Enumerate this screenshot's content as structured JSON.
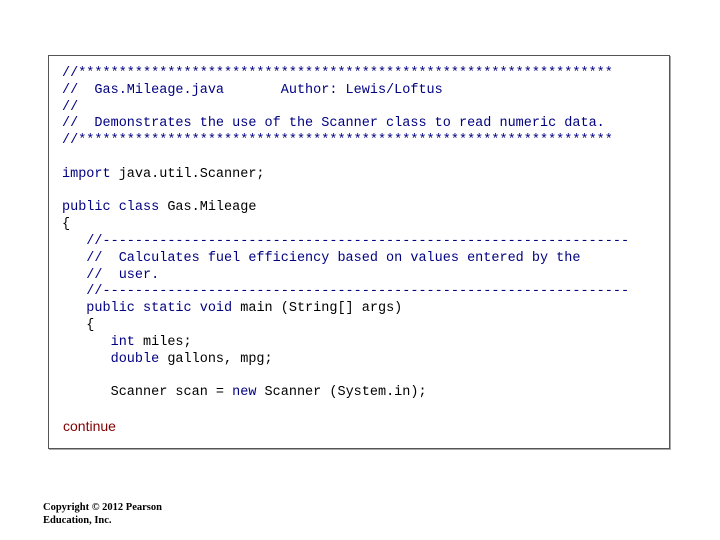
{
  "code_lines": [
    [
      {
        "t": "//******************************************************************",
        "c": "comment"
      }
    ],
    [
      {
        "t": "//  Gas.Mileage.java       Author: Lewis/Loftus",
        "c": "comment"
      }
    ],
    [
      {
        "t": "//",
        "c": "comment"
      }
    ],
    [
      {
        "t": "//  Demonstrates the use of the Scanner class to read numeric data.",
        "c": "comment"
      }
    ],
    [
      {
        "t": "//******************************************************************",
        "c": "comment"
      }
    ],
    [],
    [
      {
        "t": "import",
        "c": "kw"
      },
      {
        "t": " java.util.Scanner;",
        "c": "plain"
      }
    ],
    [],
    [
      {
        "t": "public class",
        "c": "kw"
      },
      {
        "t": " Gas.Mileage",
        "c": "plain"
      }
    ],
    [
      {
        "t": "{",
        "c": "plain"
      }
    ],
    [
      {
        "t": "   //-----------------------------------------------------------------",
        "c": "comment"
      }
    ],
    [
      {
        "t": "   //  Calculates fuel efficiency based on values entered by the",
        "c": "comment"
      }
    ],
    [
      {
        "t": "   //  user.",
        "c": "comment"
      }
    ],
    [
      {
        "t": "   //-----------------------------------------------------------------",
        "c": "comment"
      }
    ],
    [
      {
        "t": "   public static void",
        "c": "kw"
      },
      {
        "t": " main (String[] args)",
        "c": "plain"
      }
    ],
    [
      {
        "t": "   {",
        "c": "plain"
      }
    ],
    [
      {
        "t": "      ",
        "c": "plain"
      },
      {
        "t": "int",
        "c": "kw"
      },
      {
        "t": " miles;",
        "c": "plain"
      }
    ],
    [
      {
        "t": "      ",
        "c": "plain"
      },
      {
        "t": "double",
        "c": "kw"
      },
      {
        "t": " gallons, mpg;",
        "c": "plain"
      }
    ],
    [],
    [
      {
        "t": "      Scanner scan = ",
        "c": "plain"
      },
      {
        "t": "new",
        "c": "kw"
      },
      {
        "t": " Scanner (System.in);",
        "c": "plain"
      }
    ]
  ],
  "continue_label": "continue",
  "copyright": {
    "line1": "Copyright © 2012 Pearson",
    "line2": "Education, Inc."
  }
}
